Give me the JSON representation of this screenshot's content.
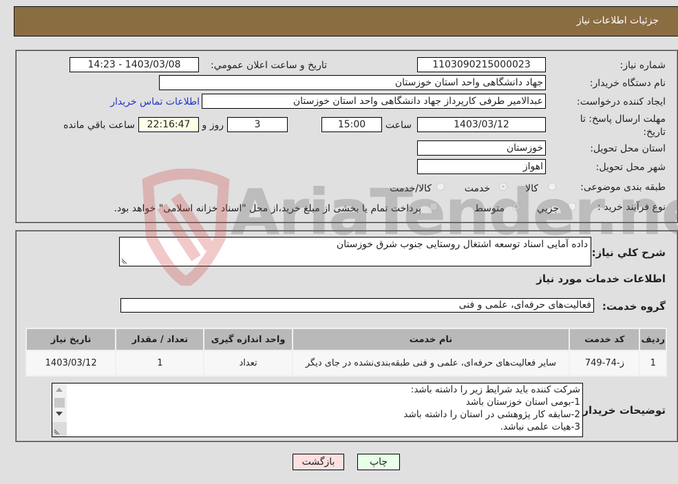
{
  "header": {
    "title": "جزئیات اطلاعات نیاز"
  },
  "fields": {
    "need_number": {
      "label": "شماره نیاز:",
      "value": "1103090215000023"
    },
    "announce_datetime": {
      "label": "تاریخ و ساعت اعلان عمومي:",
      "value": "1403/03/08 - 14:23"
    },
    "buyer_org": {
      "label": "نام دستگاه خریدار:",
      "value": "جهاد دانشگاهی واحد استان خوزستان"
    },
    "creator": {
      "label": "ایجاد کننده درخواست:",
      "value": "عبدالامیر طرفی کارپرداز جهاد دانشگاهی واحد استان خوزستان"
    },
    "buyer_contact_link": "اطلاعات تماس خریدار",
    "deadline": {
      "label": "مهلت ارسال پاسخ: تا تاریخ:",
      "date": "1403/03/12",
      "time_label": "ساعت",
      "time": "15:00",
      "days": "3",
      "days_label": "روز و",
      "remaining": "22:16:47",
      "remaining_label": "ساعت باقي مانده"
    },
    "delivery_province": {
      "label": "استان محل تحویل:",
      "value": "خوزستان"
    },
    "delivery_city": {
      "label": "شهر محل تحویل:",
      "value": "اهواز"
    },
    "category": {
      "label": "طبقه بندی موضوعی:",
      "options": [
        "کالا",
        "خدمت",
        "کالا/خدمت"
      ],
      "selected": "خدمت"
    },
    "purchase_type": {
      "label": "نوع فرآیند خرید :",
      "options": [
        "جزيي",
        "متوسط"
      ],
      "selected": "متوسط",
      "treasury_note": "پرداخت تمام یا بخشی از مبلغ خرید،از محل \"اسناد خزانه اسلامی\" خواهد بود."
    }
  },
  "description": {
    "label": "شرح کلي نياز:",
    "value": "داده آمایی اسناد توسعه اشتغال روستایی جنوب شرق خوزستان"
  },
  "services_section": {
    "title": "اطلاعات خدمات مورد نیاز",
    "group_label": "گروه خدمت:",
    "group_value": "فعالیت‌های حرفه‌ای، علمی و فنی",
    "table": {
      "columns": [
        "ردیف",
        "کد خدمت",
        "نام خدمت",
        "واحد اندازه گیری",
        "تعداد / مقدار",
        "تاریخ نیاز"
      ],
      "rows": [
        [
          "1",
          "ز-74-749",
          "سایر فعالیت‌های حرفه‌ای، علمی و فنی طبقه‌بندی‌نشده در جای دیگر",
          "تعداد",
          "1",
          "1403/03/12"
        ]
      ]
    }
  },
  "buyer_notes": {
    "label": "توضیحات خریدار:",
    "lines": [
      "شرکت کننده باید شرایط زیر را داشته باشد:",
      "1-بومی استان خوزستان باشد",
      "2-سابقه کار پژوهشی در استان را داشته باشد",
      "3-هیات علمی نباشد."
    ]
  },
  "buttons": {
    "print": "چاپ",
    "back": "بازگشت"
  },
  "watermark": "AriaTender.neT",
  "colors": {
    "header_bg": "#8b6d42",
    "print_btn_bg": "#e8ffe8",
    "back_btn_bg": "#ffe0e0",
    "link": "#2233cc"
  }
}
